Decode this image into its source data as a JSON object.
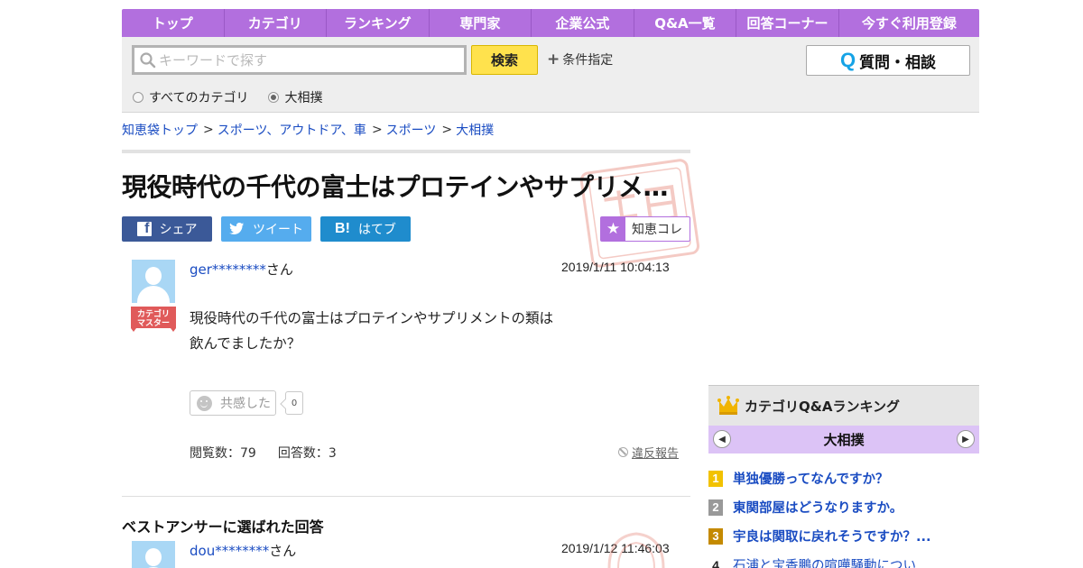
{
  "nav": {
    "items": [
      "トップ",
      "カテゴリ",
      "ランキング",
      "専門家",
      "企業公式",
      "Q&A一覧",
      "回答コーナー",
      "今すぐ利用登録"
    ]
  },
  "search": {
    "placeholder": "キーワードで探す",
    "button": "検索",
    "conditions": "条件指定",
    "ask_button": "質問・相談",
    "radio_all": "すべてのカテゴリ",
    "radio_current": "大相撲"
  },
  "breadcrumb": [
    "知恵袋トップ",
    "スポーツ、アウトドア、車",
    "スポーツ",
    "大相撲"
  ],
  "question": {
    "title": "現役時代の千代の富士はプロテインやサプリメ…",
    "share_fb": "シェア",
    "share_tw": "ツイート",
    "share_hb": "はてブ",
    "chie_colle": "知恵コレ",
    "user": "ger********",
    "san": "さん",
    "badge_line1": "カテゴリ",
    "badge_line2": "マスター",
    "date": "2019/1/11  10:04:13",
    "body_line1": "現役時代の千代の富士はプロテインやサプリメントの類は",
    "body_line2": "飲んでましたか？",
    "empathy_label": "共感した",
    "empathy_count": "0",
    "views": "閲覧数：79",
    "answers": "回答数：3",
    "report": "違反報告"
  },
  "best_answer": {
    "heading": "ベストアンサーに選ばれた回答",
    "user": "dou********",
    "san": "さん",
    "date": "2019/1/12  11:46:03"
  },
  "ranking": {
    "title": "カテゴリQ&Aランキング",
    "category": "大相撲",
    "items": [
      {
        "rank": "1",
        "text": "単独優勝ってなんですか？",
        "color": "#f2c200"
      },
      {
        "rank": "2",
        "text": "東関部屋はどうなりますか。",
        "color": "#999999"
      },
      {
        "rank": "3",
        "text": "宇良は関取に戻れそうですか？...",
        "color": "#c48a00"
      },
      {
        "rank": "4",
        "text": "石浦と宝香鵬の喧嘩騒動につい...",
        "color": ""
      }
    ]
  },
  "colors": {
    "nav": "#b26fde",
    "link": "#1a4cc2",
    "search_button": "#ffe24d"
  }
}
